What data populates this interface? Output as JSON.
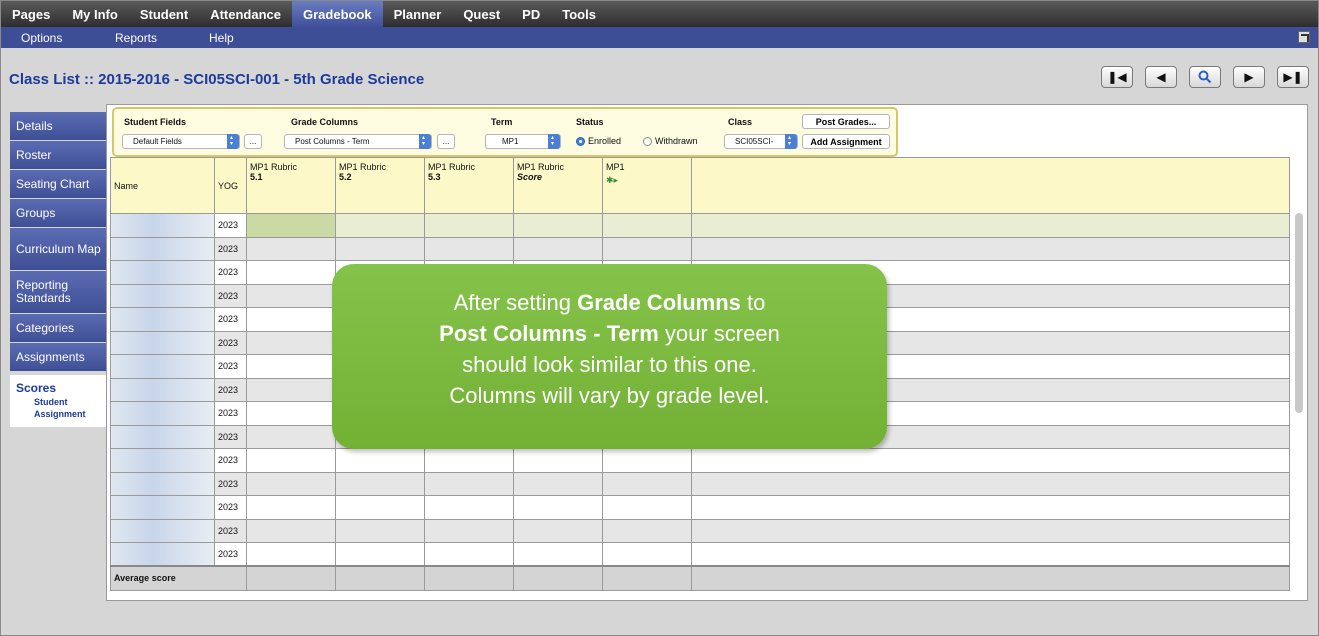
{
  "topnav": {
    "items": [
      {
        "label": "Pages"
      },
      {
        "label": "My Info"
      },
      {
        "label": "Student"
      },
      {
        "label": "Attendance"
      },
      {
        "label": "Gradebook"
      },
      {
        "label": "Planner"
      },
      {
        "label": "Quest"
      },
      {
        "label": "PD"
      },
      {
        "label": "Tools"
      }
    ],
    "active": "Gradebook"
  },
  "subnav": {
    "items": [
      {
        "label": "Options"
      },
      {
        "label": "Reports"
      },
      {
        "label": "Help"
      }
    ]
  },
  "page_title": "Class List :: 2015-2016 - SCI05SCI-001 - 5th Grade Science",
  "nav_buttons": {
    "first": "first-record-icon",
    "prev": "previous-record-icon",
    "search": "search-icon",
    "next": "next-record-icon",
    "last": "last-record-icon"
  },
  "sidebar": {
    "items": [
      {
        "label": "Details"
      },
      {
        "label": "Roster"
      },
      {
        "label": "Seating Chart"
      },
      {
        "label": "Groups"
      },
      {
        "label": "Curriculum Map"
      },
      {
        "label": "Reporting Standards"
      },
      {
        "label": "Categories"
      },
      {
        "label": "Assignments"
      }
    ],
    "scores": {
      "label": "Scores",
      "sub": [
        "Student",
        "Assignment"
      ]
    }
  },
  "filters": {
    "student_fields": {
      "label": "Student Fields",
      "value": "Default Fields",
      "more": "..."
    },
    "grade_columns": {
      "label": "Grade Columns",
      "value": "Post Columns - Term",
      "more": "..."
    },
    "term": {
      "label": "Term",
      "value": "MP1"
    },
    "status": {
      "label": "Status",
      "options": [
        "Enrolled",
        "Withdrawn"
      ],
      "selected": "Enrolled"
    },
    "class": {
      "label": "Class",
      "value": "SCI05SCI-"
    },
    "post_grades": "Post Grades...",
    "add_assignment": "Add Assignment"
  },
  "grid": {
    "headers": {
      "name": "Name",
      "yog": "YOG",
      "columns": [
        {
          "line1": "MP1 Rubric",
          "line2": "5.1"
        },
        {
          "line1": "MP1 Rubric",
          "line2": "5.2"
        },
        {
          "line1": "MP1 Rubric",
          "line2": "5.3"
        },
        {
          "line1": "MP1 Rubric",
          "line2": "Score"
        },
        {
          "line1": "MP1",
          "line2": ""
        }
      ]
    },
    "yog": [
      "2023",
      "2023",
      "2023",
      "2023",
      "2023",
      "2023",
      "2023",
      "2023",
      "2023",
      "2023",
      "2023",
      "2023",
      "2023",
      "2023",
      "2023"
    ],
    "average_label": "Average score"
  },
  "callout": {
    "t1": "After setting ",
    "b1": "Grade Columns",
    "t2": " to",
    "b2": "Post Columns - Term",
    "t3": " your screen",
    "line3": "should look similar to this one.",
    "line4": "Columns will vary by grade level."
  },
  "colors": {
    "nav_blue": "#3d4d96",
    "title_blue": "#1d3a9c",
    "header_yellow": "#fcf8c8",
    "callout_green": "#7aba3c"
  }
}
